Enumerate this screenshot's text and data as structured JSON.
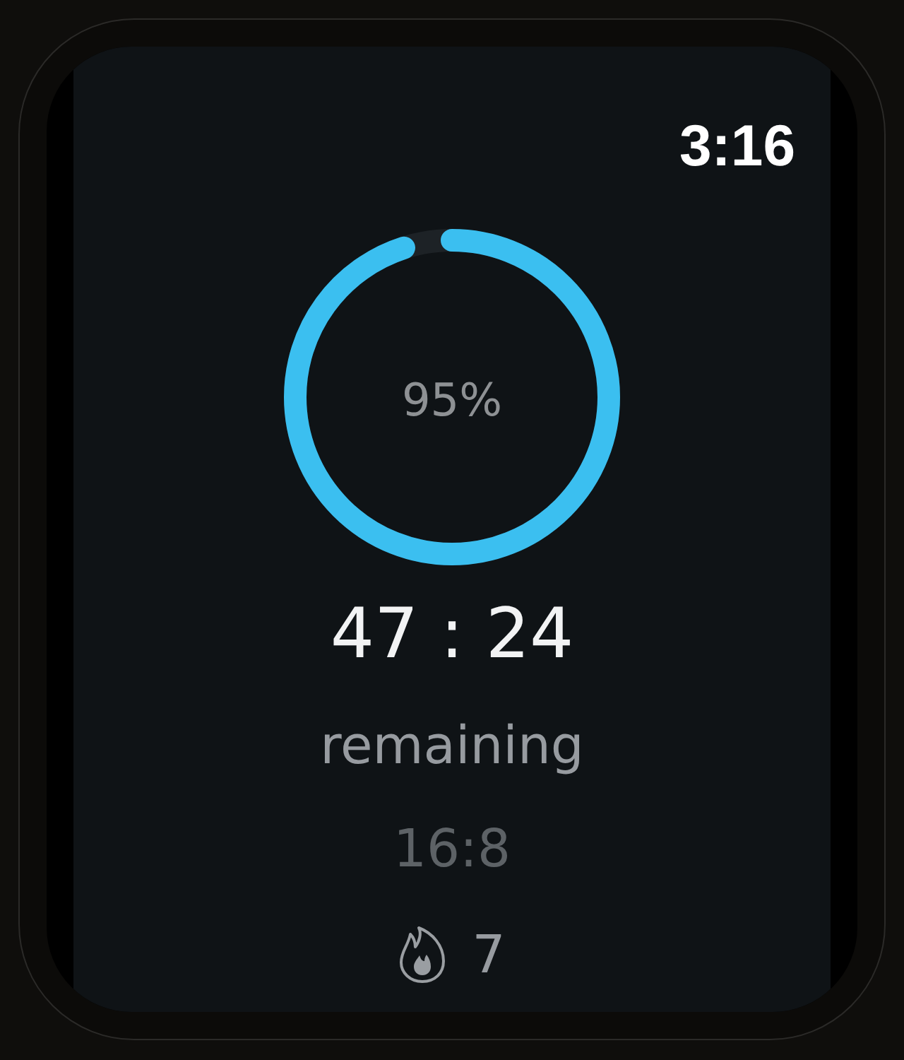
{
  "status_time": "3:16",
  "progress": {
    "level": 0.95,
    "label": "95%"
  },
  "countdown": "47 : 24",
  "caption": "remaining",
  "plan": "16:8",
  "streak": {
    "count": "7"
  }
}
